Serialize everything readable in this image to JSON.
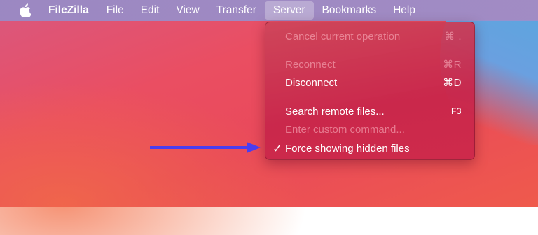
{
  "menubar": {
    "app_name": "FileZilla",
    "items": [
      {
        "label": "File"
      },
      {
        "label": "Edit"
      },
      {
        "label": "View"
      },
      {
        "label": "Transfer"
      },
      {
        "label": "Server",
        "active": true
      },
      {
        "label": "Bookmarks"
      },
      {
        "label": "Help"
      }
    ]
  },
  "server_menu": {
    "items": [
      {
        "label": "Cancel current operation",
        "shortcut": "⌘ .",
        "enabled": false
      },
      {
        "label": "Reconnect",
        "shortcut": "⌘R",
        "enabled": false
      },
      {
        "label": "Disconnect",
        "shortcut": "⌘D",
        "enabled": true
      },
      {
        "label": "Search remote files...",
        "shortcut": "F3",
        "enabled": true
      },
      {
        "label": "Enter custom command...",
        "shortcut": "",
        "enabled": false
      },
      {
        "label": "Force showing hidden files",
        "shortcut": "",
        "enabled": true,
        "checked": true,
        "check_mark": "✓"
      }
    ]
  },
  "colors": {
    "annotation_arrow": "#4a3df0"
  }
}
